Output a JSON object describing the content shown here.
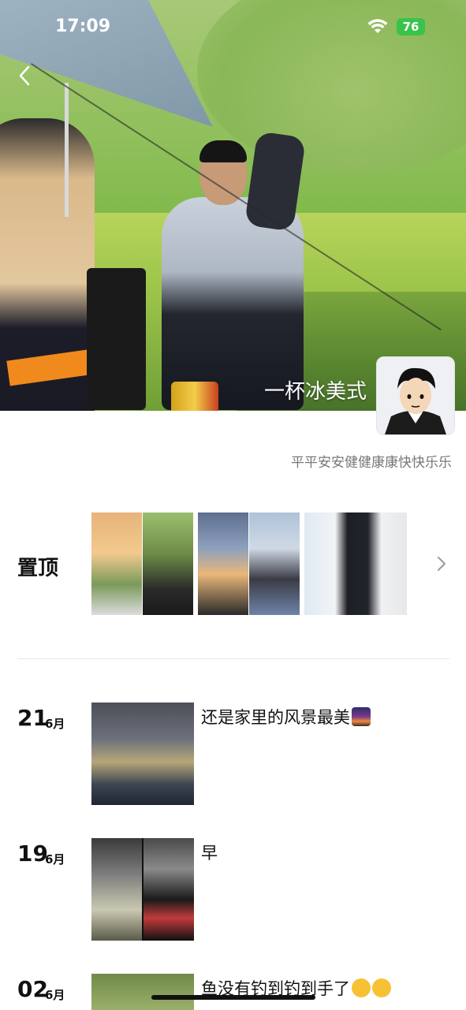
{
  "status_bar": {
    "time": "17:09",
    "battery": "76"
  },
  "profile": {
    "nickname": "一杯冰美式",
    "signature": "平平安安健健康康快快乐乐"
  },
  "pinned": {
    "label": "置顶"
  },
  "posts": [
    {
      "day": "21",
      "month": "6月",
      "text": "还是家里的风景最美"
    },
    {
      "day": "19",
      "month": "6月",
      "text": "早"
    },
    {
      "day": "02",
      "month": "6月",
      "text": "鱼没有钓到钓到手了"
    }
  ],
  "icons": {
    "back": "chevron-left-icon",
    "wifi": "wifi-icon",
    "more": "chevron-right-icon"
  },
  "colors": {
    "battery": "#39c34a",
    "signature": "#777777"
  }
}
